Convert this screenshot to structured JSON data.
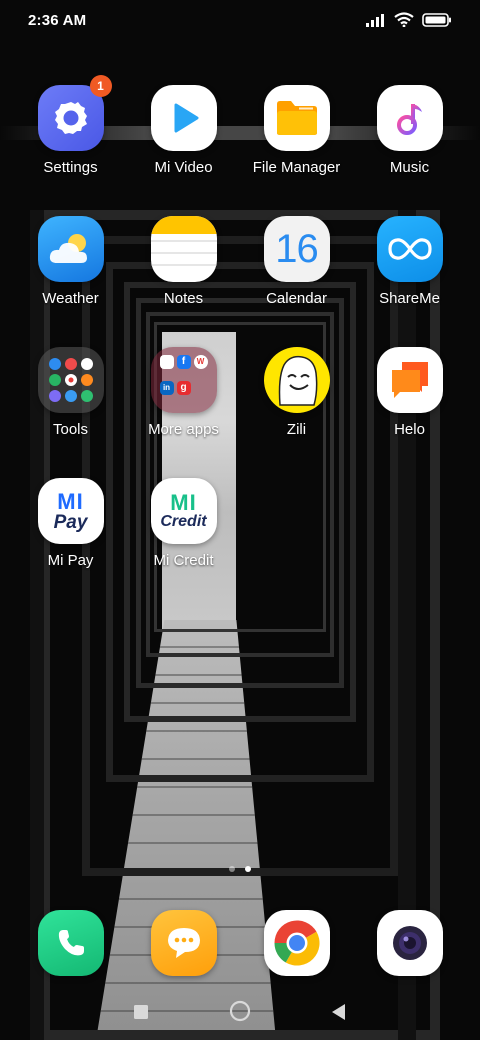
{
  "status_bar": {
    "time": "2:36 AM",
    "icons": [
      "signal-icon",
      "wifi-icon",
      "battery-icon"
    ]
  },
  "apps": [
    {
      "name": "settings",
      "label": "Settings",
      "icon": "settings-icon",
      "badge": "1"
    },
    {
      "name": "mi-video",
      "label": "Mi Video",
      "icon": "play-icon"
    },
    {
      "name": "file-manager",
      "label": "File Manager",
      "icon": "folder-icon"
    },
    {
      "name": "music",
      "label": "Music",
      "icon": "music-note-icon"
    },
    {
      "name": "weather",
      "label": "Weather",
      "icon": "weather-icon"
    },
    {
      "name": "notes",
      "label": "Notes",
      "icon": "notes-icon"
    },
    {
      "name": "calendar",
      "label": "Calendar",
      "icon": "calendar-icon",
      "icon_text": "16"
    },
    {
      "name": "shareme",
      "label": "ShareMe",
      "icon": "shareme-icon"
    },
    {
      "name": "tools",
      "label": "Tools",
      "icon": "folder-grid-icon"
    },
    {
      "name": "more-apps",
      "label": "More apps",
      "icon": "folder-grid-icon"
    },
    {
      "name": "zili",
      "label": "Zili",
      "icon": "zili-face-icon"
    },
    {
      "name": "helo",
      "label": "Helo",
      "icon": "helo-chat-icon"
    },
    {
      "name": "mi-pay",
      "label": "Mi Pay",
      "icon": "mi-pay-icon",
      "icon_text": [
        "MI",
        "Pay"
      ]
    },
    {
      "name": "mi-credit",
      "label": "Mi Credit",
      "icon": "mi-credit-icon",
      "icon_text": [
        "MI",
        "Credit"
      ]
    }
  ],
  "more_apps_mini": [
    "f",
    "W",
    "in",
    "g"
  ],
  "page_indicator": {
    "pages": 2,
    "active": 2
  },
  "dock": [
    {
      "name": "phone",
      "icon": "phone-icon"
    },
    {
      "name": "messaging",
      "icon": "chat-bubble-icon"
    },
    {
      "name": "chrome",
      "icon": "chrome-icon"
    },
    {
      "name": "camera",
      "icon": "camera-icon"
    }
  ],
  "nav_bar": [
    "recents-square-icon",
    "home-circle-icon",
    "back-triangle-icon"
  ],
  "colors": {
    "badge": "#f05a24",
    "settings_bg": "#5b6ff2",
    "mi_video_play": "#29a6f5",
    "file_manager": "#ffb300",
    "weather_bg": "#1e9bf0",
    "shareme_bg": "#1aa3f0",
    "phone_bg": "#1fcf86",
    "messaging_bg": "#ffb31a"
  }
}
